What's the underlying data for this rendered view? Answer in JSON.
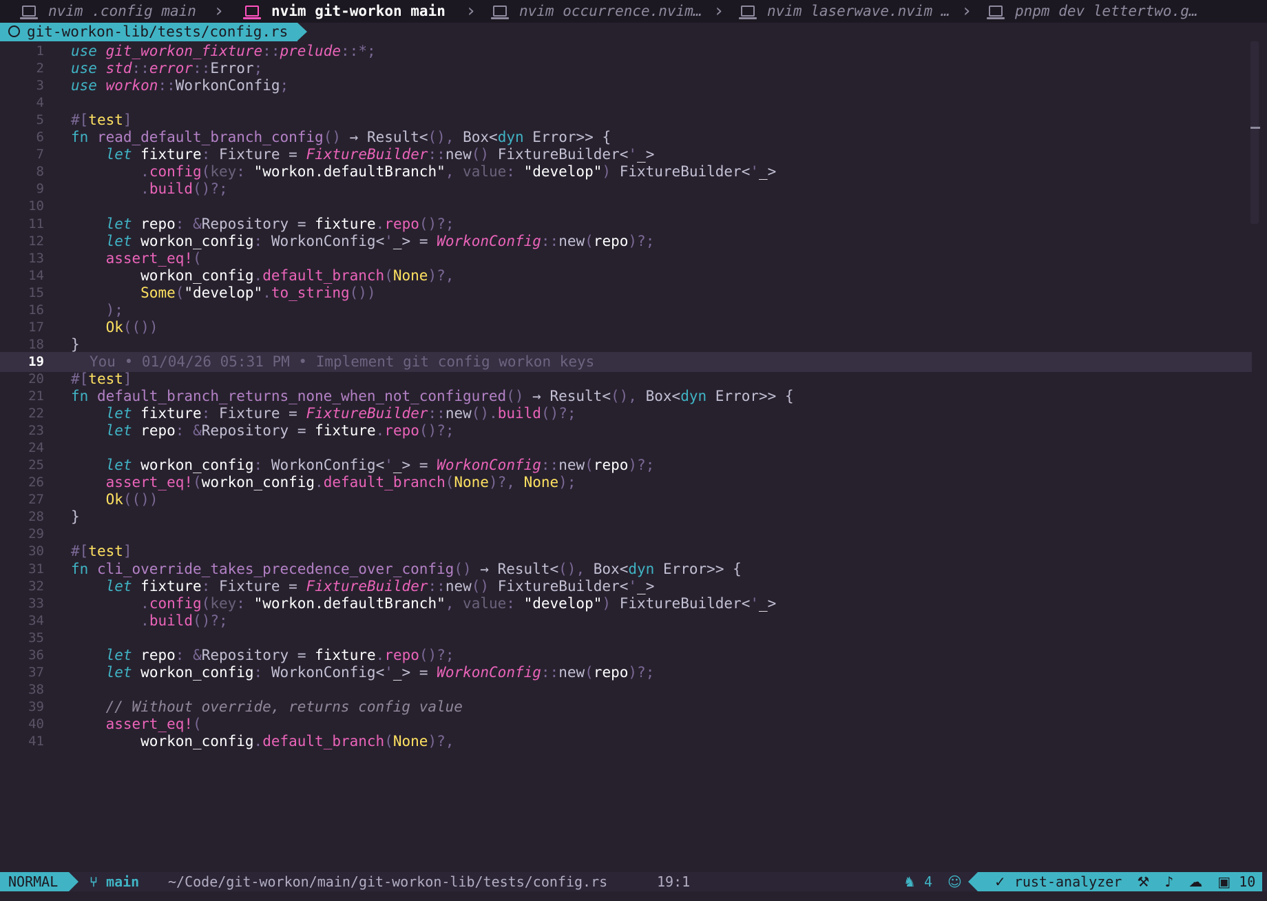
{
  "tabs": [
    {
      "label": "nvim .config main",
      "active": false
    },
    {
      "label": "nvim git-workon main",
      "active": true
    },
    {
      "label": "nvim occurrence.nvim…",
      "active": false
    },
    {
      "label": "nvim laserwave.nvim …",
      "active": false
    },
    {
      "label": "pnpm dev lettertwo.g…",
      "active": false
    }
  ],
  "winbar": {
    "file": "git-workon-lib/tests/config.rs"
  },
  "editor": {
    "cursor_line": 19,
    "blame": "You • 01/04/26 05:31 PM • Implement git config workon keys",
    "line_numbers": [
      "1",
      "2",
      "3",
      "4",
      "5",
      "6",
      "7",
      "8",
      "9",
      "10",
      "11",
      "12",
      "13",
      "14",
      "15",
      "16",
      "17",
      "18",
      "19",
      "20",
      "21",
      "22",
      "23",
      "24",
      "25",
      "26",
      "27",
      "28",
      "29",
      "30",
      "31",
      "32",
      "33",
      "34",
      "35",
      "36",
      "37",
      "38",
      "39",
      "40",
      "41"
    ],
    "lines": [
      "use git_workon_fixture::prelude::*;",
      "use std::error::Error;",
      "use workon::WorkonConfig;",
      "",
      "#[test]",
      "fn read_default_branch_config() → Result<(), Box<dyn Error>> {",
      "    let fixture: Fixture = FixtureBuilder::new() FixtureBuilder<'_>",
      "        .config(key: \"workon.defaultBranch\", value: \"develop\") FixtureBuilder<'_>",
      "        .build()?;",
      "",
      "    let repo: &Repository = fixture.repo()?;",
      "    let workon_config: WorkonConfig<'_> = WorkonConfig::new(repo)?;",
      "    assert_eq!(",
      "        workon_config.default_branch(None)?,",
      "        Some(\"develop\".to_string())",
      "    );",
      "    Ok(())",
      "}",
      "",
      "#[test]",
      "fn default_branch_returns_none_when_not_configured() → Result<(), Box<dyn Error>> {",
      "    let fixture: Fixture = FixtureBuilder::new().build()?;",
      "    let repo: &Repository = fixture.repo()?;",
      "",
      "    let workon_config: WorkonConfig<'_> = WorkonConfig::new(repo)?;",
      "    assert_eq!(workon_config.default_branch(None)?, None);",
      "    Ok(())",
      "}",
      "",
      "#[test]",
      "fn cli_override_takes_precedence_over_config() → Result<(), Box<dyn Error>> {",
      "    let fixture: Fixture = FixtureBuilder::new() FixtureBuilder<'_>",
      "        .config(key: \"workon.defaultBranch\", value: \"develop\") FixtureBuilder<'_>",
      "        .build()?;",
      "",
      "    let repo: &Repository = fixture.repo()?;",
      "    let workon_config: WorkonConfig<'_> = WorkonConfig::new(repo)?;",
      "",
      "    // Without override, returns config value",
      "    assert_eq!(",
      "        workon_config.default_branch(None)?,"
    ]
  },
  "status": {
    "mode": "NORMAL",
    "branch": "main",
    "path": "~/Code/git-workon/main/git-workon-lib/tests/config.rs",
    "position": "19:1",
    "copilot_count": "4",
    "lsp": "rust-analyzer",
    "count": "10"
  },
  "colors": {
    "background": "#27212e",
    "accent": "#40b4c4",
    "pink": "#eb64b9",
    "purple": "#b381c5",
    "yellow": "#ffe261"
  },
  "icons": [
    "terminal-icon",
    "github-icon",
    "git-branch-icon",
    "robot-icon",
    "copilot-icon",
    "check-icon",
    "brush-icon",
    "bell-icon",
    "cloud-icon",
    "box-icon"
  ]
}
